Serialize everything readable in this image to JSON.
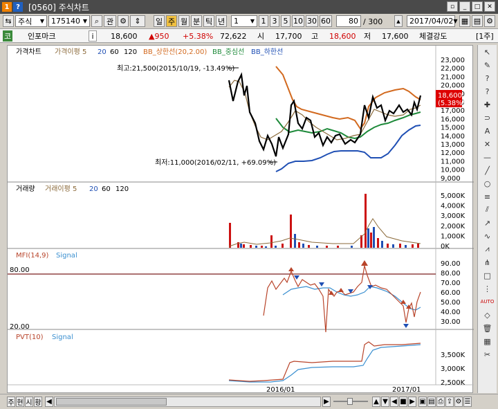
{
  "window": {
    "icon_a": "1",
    "icon_b": "?",
    "title": "[0560] 주식차트"
  },
  "toolbar": {
    "market": "주식",
    "code": "175140",
    "btn_gwan": "관",
    "period_buttons": [
      "일",
      "주",
      "월",
      "분",
      "틱",
      "년"
    ],
    "interval_value": "1",
    "interval_presets": [
      "1",
      "3",
      "5",
      "10",
      "30",
      "60"
    ],
    "count_value": "80",
    "count_total": "/ 300",
    "date": "2017/04/02"
  },
  "info": {
    "icon": "코",
    "name": "인포마크",
    "i_btn": "i",
    "price": "18,600",
    "change": "▲950",
    "change_pct": "+5.38%",
    "volume": "72,622",
    "open_label": "시",
    "open": "17,700",
    "high_label": "고",
    "high": "18,600",
    "low_label": "저",
    "low": "17,600",
    "strength_label": "체결강도",
    "unit": "[1주]"
  },
  "price_pane": {
    "legend": [
      "가격차트",
      "가격이평 5",
      "20",
      "60",
      "120",
      "BB_상한선(20,2.00)",
      "BB_중심선",
      "BB_하한선"
    ],
    "max_label": "최고:21,500(2015/10/19, -13.49%)",
    "min_label": "최저:11,000(2016/02/11, +69.09%)",
    "yticks": [
      "23,000",
      "22,000",
      "21,000",
      "20,000",
      "19,000",
      "18,000",
      "17,000",
      "16,000",
      "15,000",
      "14,000",
      "13,000",
      "12,000",
      "11,000",
      "10,000",
      "9,000"
    ],
    "current_price": "18,600",
    "current_pct": "(5.38%)"
  },
  "volume_pane": {
    "legend": [
      "거래량",
      "거래이평 5",
      "20",
      "60",
      "120"
    ],
    "yticks": [
      "5,000K",
      "4,000K",
      "3,000K",
      "2,000K",
      "1,000K",
      "0K"
    ]
  },
  "mfi_pane": {
    "legend": [
      "MFI(14,9)",
      "Signal"
    ],
    "level_hi": "80.00",
    "level_lo": "20.00",
    "yticks": [
      "90.00",
      "80.00",
      "70.00",
      "60.00",
      "50.00",
      "40.00",
      "30.00"
    ]
  },
  "pvt_pane": {
    "legend": [
      "PVT(10)",
      "Signal"
    ],
    "yticks": [
      "3,500K",
      "3,000K",
      "2,500K"
    ]
  },
  "xaxis": {
    "labels": [
      "2016/01",
      "2017/01"
    ]
  },
  "bottom": {
    "tabs": [
      "주",
      "현",
      "시",
      "황"
    ]
  },
  "colors": {
    "price": "#000000",
    "ma5": "#8b6a3a",
    "bb_upper": "#d2691e",
    "bb_mid": "#1e8a3a",
    "bb_lower": "#1f4fb4",
    "vol_bar": "#cc1111",
    "mfi": "#b8442a",
    "signal": "#3a8fd0",
    "pvt": "#b8442a"
  }
}
